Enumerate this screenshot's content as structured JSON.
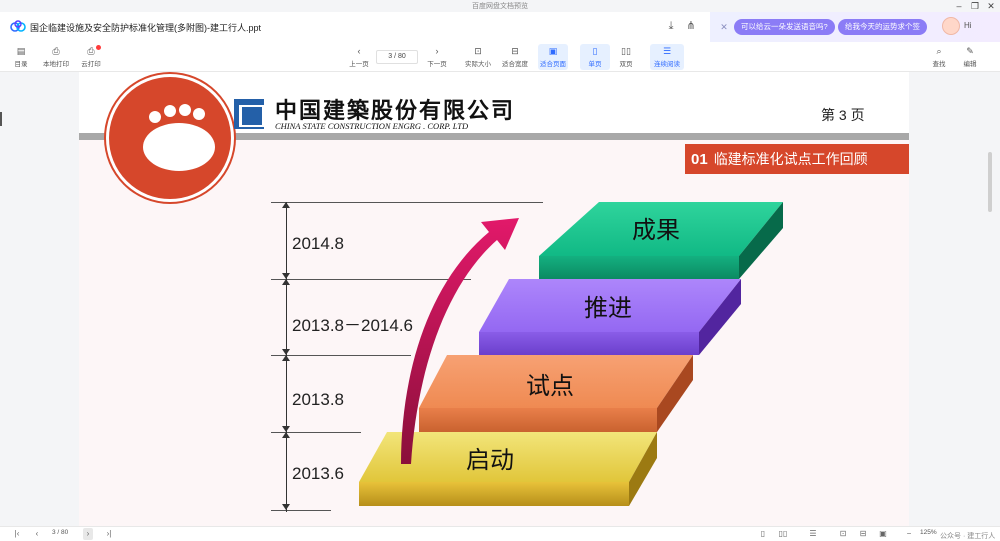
{
  "window": {
    "title": "百度网盘文档预览",
    "minimize_icon": "minimize-icon",
    "restore_icon": "restore-icon",
    "close_icon": "close-icon"
  },
  "header": {
    "doc_title": "国企临建设施及安全防护标准化管理(多附图)-建工行人.ppt",
    "download_icon": "download-icon",
    "share_icon": "share-icon"
  },
  "ai_bar": {
    "chips": [
      "可以给云一朵发送语音吗?",
      "给我今天的运势求个签"
    ],
    "greeting": "Hi"
  },
  "toolbar": {
    "left": [
      {
        "icon": "catalog-icon",
        "label": "目录"
      },
      {
        "icon": "print-icon",
        "label": "本地打印"
      },
      {
        "icon": "cloud-print-icon",
        "label": "云打印"
      }
    ],
    "prev_label": "上一页",
    "next_label": "下一页",
    "page_indicator": "3 / 80",
    "views": [
      {
        "label": "实际大小",
        "active": false
      },
      {
        "label": "适合宽度",
        "active": false
      },
      {
        "label": "适合页面",
        "active": true
      },
      {
        "label": "单页",
        "active": true
      },
      {
        "label": "双页",
        "active": false
      },
      {
        "label": "连续阅读",
        "active": true
      }
    ],
    "right": [
      {
        "icon": "search-icon",
        "label": "查找"
      },
      {
        "icon": "edit-icon",
        "label": "编辑"
      }
    ]
  },
  "slide": {
    "company_cn": "中国建築股份有限公司",
    "company_en": "CHINA STATE CONSTRUCTION ENGRG . CORP. LTD",
    "page_label": "第 3 页",
    "section_number": "01",
    "section_title": "临建标准化试点工作回顾",
    "timeline": [
      {
        "date": "2014.8",
        "step": "成果"
      },
      {
        "date": "2013.8－2014.6",
        "step": "推进"
      },
      {
        "date": "2013.8",
        "step": "试点"
      },
      {
        "date": "2013.6",
        "step": "启动"
      }
    ],
    "colors": {
      "brand_red": "#d6472b",
      "step_result": "#1cc58e",
      "step_advance": "#9b72f5",
      "step_pilot": "#f3935b",
      "step_start": "#e9d14c",
      "arrow": "#c8145a"
    }
  },
  "statusbar": {
    "page_indicator": "3 / 80",
    "zoom": "125%",
    "watermark": "公众号 · 建工行人"
  }
}
